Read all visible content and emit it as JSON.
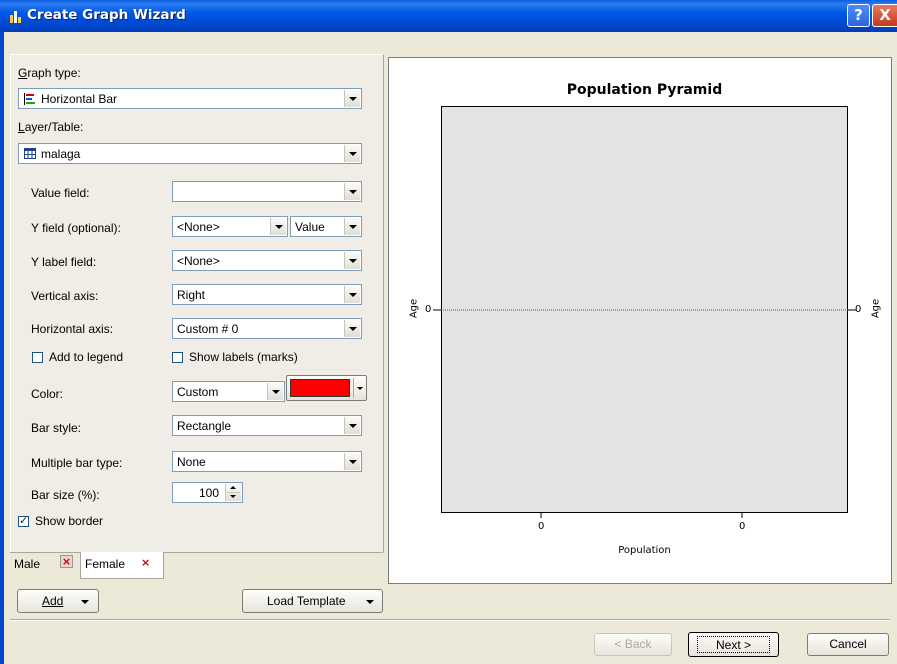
{
  "window": {
    "title": "Create Graph Wizard",
    "help_label": "?",
    "close_label": "X"
  },
  "form": {
    "graph_type": {
      "label": "Graph type:",
      "value": "Horizontal Bar"
    },
    "layer_table": {
      "label": "Layer/Table:",
      "value": "malaga"
    },
    "value_field": {
      "label": "Value field:",
      "value": ""
    },
    "y_field": {
      "label": "Y field (optional):",
      "value": "<None>",
      "mode": "Value"
    },
    "y_label_field": {
      "label": "Y label field:",
      "value": "<None>"
    },
    "vertical_axis": {
      "label": "Vertical axis:",
      "value": "Right"
    },
    "horizontal_axis": {
      "label": "Horizontal axis:",
      "value": "Custom # 0"
    },
    "add_to_legend": {
      "label": "Add to legend",
      "checked": false
    },
    "show_labels": {
      "label": "Show labels (marks)",
      "checked": false
    },
    "color": {
      "label": "Color:",
      "value": "Custom",
      "swatch": "#ff0000"
    },
    "bar_style": {
      "label": "Bar style:",
      "value": "Rectangle"
    },
    "multiple_bar_type": {
      "label": "Multiple bar type:",
      "value": "None"
    },
    "bar_size": {
      "label": "Bar size (%):",
      "value": "100"
    },
    "show_border": {
      "label": "Show border",
      "checked": true
    }
  },
  "tabs": [
    {
      "label": "Male",
      "close": "×",
      "active": false
    },
    {
      "label": "Female",
      "close": "×",
      "active": true
    }
  ],
  "buttons": {
    "add": "Add",
    "load_template": "Load Template",
    "back": "< Back",
    "next": "Next >",
    "cancel": "Cancel"
  },
  "chart_data": {
    "type": "bar",
    "orientation": "horizontal",
    "title": "Population Pyramid",
    "xlabel": "Population",
    "ylabel_left": "Age",
    "ylabel_right": "Age",
    "x_tick_labels": [
      "0",
      "0"
    ],
    "y_tick_left": "0",
    "y_tick_right": "0",
    "series": [],
    "background": "#e3e3e3",
    "reference_line": "dotted horizontal at 0",
    "grid": false
  }
}
